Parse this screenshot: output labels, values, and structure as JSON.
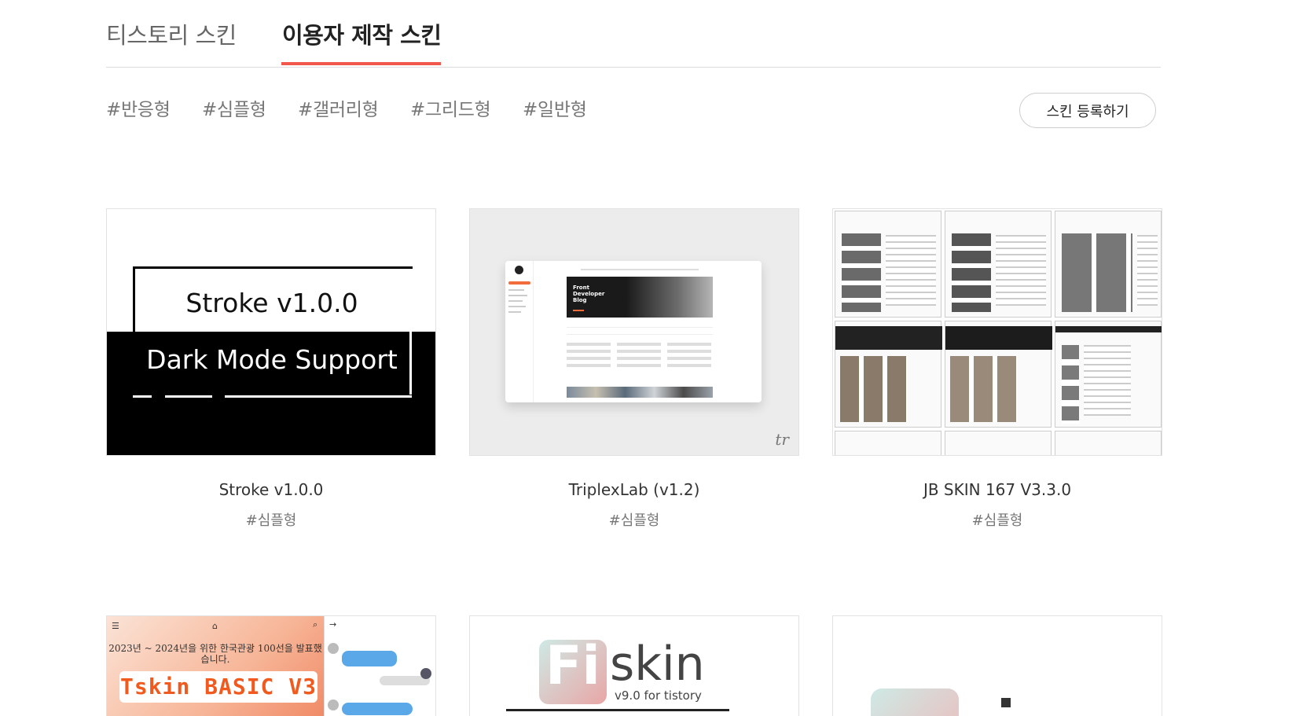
{
  "tabs": [
    {
      "label": "티스토리 스킨",
      "active": false
    },
    {
      "label": "이용자 제작 스킨",
      "active": true
    }
  ],
  "accent_color": "#f1574a",
  "filters": [
    "#반응형",
    "#심플형",
    "#갤러리형",
    "#그리드형",
    "#일반형"
  ],
  "register_button": "스킨 등록하기",
  "cards": [
    {
      "title": "Stroke v1.0.0",
      "tag": "#심플형",
      "thumb": {
        "line1": "Stroke v1.0.0",
        "line2": "Dark Mode Support"
      }
    },
    {
      "title": "TriplexLab (v1.2)",
      "tag": "#심플형",
      "thumb": {
        "hero": "Front Developer Blog",
        "mark": "tr"
      }
    },
    {
      "title": "JB SKIN 167 V3.3.0",
      "tag": "#심플형"
    },
    {
      "thumb": {
        "headline": "2023년 ~ 2024년을 위한 한국관광 100선을 발표했습니다.",
        "logo": "Tskin BASIC V3"
      }
    },
    {
      "thumb": {
        "logo_fi": "Fi",
        "logo_skin": "skin",
        "version": "v9.0 for tistory"
      }
    },
    {}
  ]
}
